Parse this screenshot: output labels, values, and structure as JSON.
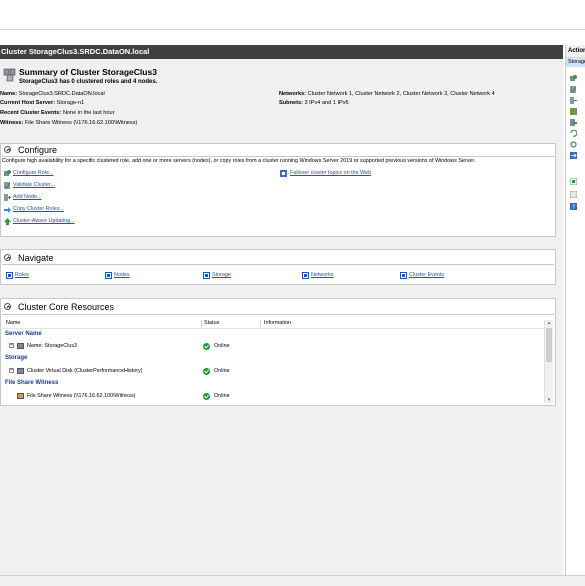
{
  "window_title": "Cluster StorageClus3.SRDC.DataON.local",
  "summary": {
    "title": "Summary of Cluster StorageClus3",
    "subtitle": "StorageClus3 has 0 clustered roles and 4 nodes.",
    "name_label": "Name:",
    "name_value": "StorageClus3.SRDC.DataON.local",
    "host_label": "Current Host Server:",
    "host_value": "Storage-n1",
    "events_label": "Recent Cluster Events:",
    "events_value": "None in the last hour",
    "witness_label": "Witness:",
    "witness_value": "File Share Witness (\\\\176.16.62.100\\Witness)",
    "networks_label": "Networks:",
    "networks_value": "Cluster Network 1, Cluster Network 2, Cluster Network 3, Cluster Network 4",
    "subnets_label": "Subnets:",
    "subnets_value": "3 IPv4 and 1 IPv6"
  },
  "configure": {
    "title": "Configure",
    "description": "Configure high availability for a specific clustered role, add one or more servers (nodes), or copy roles from a cluster running Windows Server 2019 or supported previous versions of Windows Server.",
    "actions": [
      "Configure Role...",
      "Validate Cluster...",
      "Add Node...",
      "Copy Cluster Roles...",
      "Cluster-Aware Updating..."
    ],
    "help_link": "Failover cluster topics on the Web"
  },
  "navigate": {
    "title": "Navigate",
    "links": [
      "Roles",
      "Nodes",
      "Storage",
      "Networks",
      "Cluster Events"
    ]
  },
  "core": {
    "title": "Cluster Core Resources",
    "columns": [
      "Name",
      "Status",
      "Information"
    ],
    "groups": [
      {
        "label": "Server Name",
        "rows": [
          {
            "name": "Name: StorageClus3",
            "status": "Online"
          }
        ]
      },
      {
        "label": "Storage",
        "rows": [
          {
            "name": "Cluster Virtual Disk (ClusterPerformanceHistory)",
            "status": "Online"
          }
        ]
      },
      {
        "label": "File Share Witness",
        "rows": [
          {
            "name": "File Share Witness (\\\\176.16.62.100\\Witness)",
            "status": "Online"
          }
        ]
      }
    ]
  },
  "actions_pane": {
    "title": "Actions",
    "subtitle": "Storage"
  },
  "colors": {
    "titlebar": "#404040",
    "link": "#1a55b8",
    "group_header": "#1a3a8a",
    "online": "#1c9a2b"
  }
}
